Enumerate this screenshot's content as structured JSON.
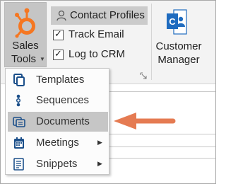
{
  "ribbon": {
    "sales_tools": {
      "label_line1": "Sales",
      "label_line2": "Tools",
      "icon": "hubspot-sprocket-icon"
    },
    "contact_profiles": {
      "label": "Contact Profiles",
      "icon": "person-icon"
    },
    "track_email": {
      "label": "Track Email",
      "checked": true
    },
    "log_to_crm": {
      "label": "Log to CRM",
      "checked": true
    },
    "customer_manager": {
      "label_line1": "Customer",
      "label_line2": "Manager",
      "icon": "outlook-contacts-icon"
    }
  },
  "menu": {
    "items": [
      {
        "label": "Templates",
        "icon": "templates-icon",
        "submenu": false
      },
      {
        "label": "Sequences",
        "icon": "sequences-icon",
        "submenu": false
      },
      {
        "label": "Documents",
        "icon": "documents-icon",
        "submenu": false,
        "highlighted": true
      },
      {
        "label": "Meetings",
        "icon": "calendar-icon",
        "submenu": true
      },
      {
        "label": "Snippets",
        "icon": "snippets-icon",
        "submenu": true
      }
    ]
  },
  "colors": {
    "hubspot_orange": "#f57722",
    "annotation_arrow": "#e57b52",
    "outlook_blue": "#1e6bbf",
    "highlight": "#c6c6c6",
    "ribbon_bg": "#f3f3f3"
  }
}
